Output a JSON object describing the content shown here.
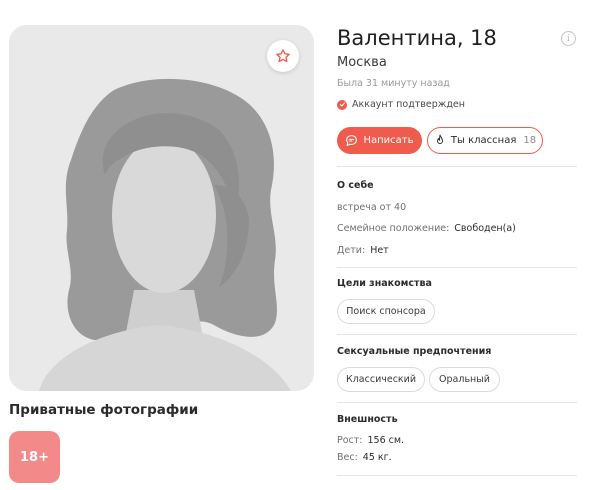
{
  "profile": {
    "name_age": "Валентина, 18",
    "city": "Москва",
    "last_seen": "Была 31 минуту назад",
    "verified": "Аккаунт подтвержден"
  },
  "actions": {
    "write_label": "Написать",
    "like_label": "Ты классная",
    "like_count": "18"
  },
  "private_photos": {
    "title": "Приватные фотографии",
    "badge": "18+"
  },
  "about": {
    "title": "О себе",
    "text": "встреча от 40",
    "marital_label": "Семейное положение:",
    "marital_value": "Свободен(а)",
    "kids_label": "Дети:",
    "kids_value": "Нет"
  },
  "goals": {
    "title": "Цели знакомства",
    "chips": [
      "Поиск спонсора"
    ]
  },
  "preferences": {
    "title": "Сексуальные предпочтения",
    "chips": [
      "Классический",
      "Оральный"
    ]
  },
  "appearance": {
    "title": "Внешность",
    "height_label": "Рост:",
    "height_value": "156 см.",
    "weight_label": "Вес:",
    "weight_value": "45 кг."
  },
  "icons": {
    "favorite": "star-icon",
    "info": "info-icon",
    "verified": "check-circle-icon",
    "write": "chat-bubble-icon",
    "like": "flame-icon"
  },
  "colors": {
    "accent": "#ef5b4c",
    "badge": "#f28a8a"
  }
}
